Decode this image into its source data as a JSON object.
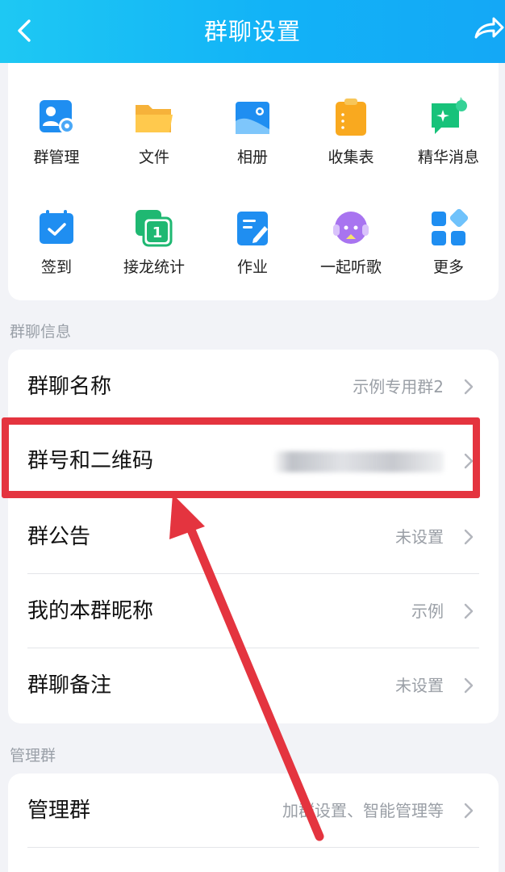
{
  "header": {
    "title": "群聊设置",
    "back_icon": "chevron-left-icon",
    "share_icon": "share-forward-icon",
    "colors": {
      "start": "#1ec8f3",
      "end": "#14a8f6"
    }
  },
  "grid": [
    {
      "label": "群管理",
      "icon": "group-manage-icon"
    },
    {
      "label": "文件",
      "icon": "folder-icon"
    },
    {
      "label": "相册",
      "icon": "photo-album-icon"
    },
    {
      "label": "收集表",
      "icon": "clipboard-form-icon"
    },
    {
      "label": "精华消息",
      "icon": "highlight-message-icon"
    },
    {
      "label": "签到",
      "icon": "calendar-checkin-icon"
    },
    {
      "label": "接龙统计",
      "icon": "chain-count-icon"
    },
    {
      "label": "作业",
      "icon": "homework-icon"
    },
    {
      "label": "一起听歌",
      "icon": "listen-music-icon"
    },
    {
      "label": "更多",
      "icon": "more-apps-icon"
    }
  ],
  "info_section": {
    "label": "群聊信息",
    "rows": [
      {
        "key": "群聊名称",
        "value": "示例专用群2"
      },
      {
        "key": "群号和二维码",
        "value": ""
      },
      {
        "key": "群公告",
        "value": "未设置"
      },
      {
        "key": "我的本群昵称",
        "value": "示例"
      },
      {
        "key": "群聊备注",
        "value": "未设置"
      }
    ]
  },
  "manage_section": {
    "label": "管理群",
    "rows": [
      {
        "key": "管理群",
        "value": "加群设置、智能管理等"
      }
    ]
  },
  "annotation": {
    "color": "#e4343f"
  }
}
